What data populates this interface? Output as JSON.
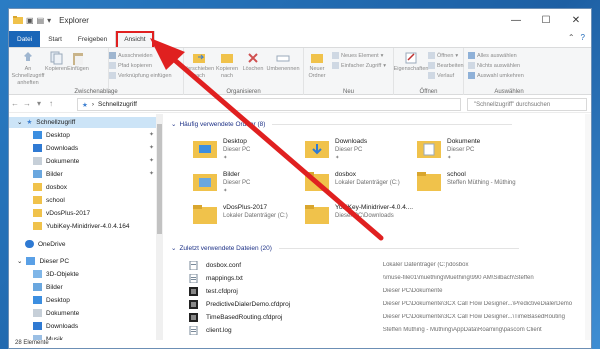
{
  "window": {
    "title": "Explorer",
    "controls": [
      "—",
      "☐",
      "✕"
    ]
  },
  "tabs": {
    "file": "Datei",
    "start": "Start",
    "share": "Freigeben",
    "view": "Ansicht"
  },
  "ribbon": {
    "pin_quick": "An Schnellzugriff anheften",
    "copy": "Kopieren",
    "paste": "Einfügen",
    "cut": "Ausschneiden",
    "copy_path": "Pfad kopieren",
    "paste_shortcut": "Verknüpfung einfügen",
    "group_clipboard": "Zwischenablage",
    "move_to": "Verschieben nach",
    "copy_to": "Kopieren nach",
    "delete": "Löschen",
    "rename": "Umbenennen",
    "group_organize": "Organisieren",
    "new_folder": "Neuer Ordner",
    "new_item": "Neues Element",
    "easy_access": "Einfacher Zugriff",
    "group_new": "Neu",
    "properties": "Eigenschaften",
    "open": "Öffnen",
    "edit": "Bearbeiten",
    "history": "Verlauf",
    "group_open": "Öffnen",
    "select_all": "Alles auswählen",
    "select_none": "Nichts auswählen",
    "invert_selection": "Auswahl umkehren",
    "group_select": "Auswählen"
  },
  "address": {
    "path": "Schnellzugriff",
    "search_placeholder": "\"Schnellzugriff\" durchsuchen"
  },
  "nav": {
    "quick_access": "Schnellzugriff",
    "items": [
      "Desktop",
      "Downloads",
      "Dokumente",
      "Bilder",
      "dosbox",
      "school",
      "vDosPlus-2017",
      "YubiKey-Minidriver-4.0.4.164"
    ],
    "onedrive": "OneDrive",
    "this_pc": "Dieser PC",
    "pc_items": [
      "3D-Objekte",
      "Bilder",
      "Desktop",
      "Dokumente",
      "Downloads",
      "Musik"
    ]
  },
  "content": {
    "frequent_header": "Häufig verwendete Ordner (8)",
    "frequent": [
      {
        "name": "Desktop",
        "sub": "Dieser PC"
      },
      {
        "name": "Downloads",
        "sub": "Dieser PC"
      },
      {
        "name": "Dokumente",
        "sub": "Dieser PC"
      },
      {
        "name": "Bilder",
        "sub": "Dieser PC"
      },
      {
        "name": "dosbox",
        "sub": "Lokaler Datenträger (C:)"
      },
      {
        "name": "school",
        "sub": "Steffen Müthing - Müthing"
      },
      {
        "name": "vDosPlus-2017",
        "sub": "Lokaler Datenträger (C:)"
      },
      {
        "name": "YubiKey-Minidriver-4.0.4....",
        "sub": "Dieser PC\\Downloads"
      }
    ],
    "recent_header": "Zuletzt verwendete Dateien (20)",
    "recent": [
      {
        "name": "dosbox.conf",
        "path": "Lokaler Datenträger (C:)\\dosbox"
      },
      {
        "name": "mappings.txt",
        "path": "\\\\muse-file01\\muething\\Muething\\990 AM\\Silbach\\Steffen"
      },
      {
        "name": "test.cfdproj",
        "path": "Dieser PC\\Dokumente"
      },
      {
        "name": "PredictiveDialerDemo.cfdproj",
        "path": "Dieser PC\\Dokumente\\3CX Call Flow Designer...\\PredictiveDialerDemo"
      },
      {
        "name": "TimeBasedRouting.cfdproj",
        "path": "Dieser PC\\Dokumente\\3CX Call Flow Designer...\\TimeBasedRouting"
      },
      {
        "name": "client.log",
        "path": "Steffen Müthing - Müthing\\AppData\\Roaming\\pascom Client"
      }
    ]
  },
  "status": {
    "count": "28 Elemente"
  },
  "colors": {
    "file_tab": "#1a66b8",
    "folder": "#f0c24b",
    "highlight": "#e02020"
  }
}
